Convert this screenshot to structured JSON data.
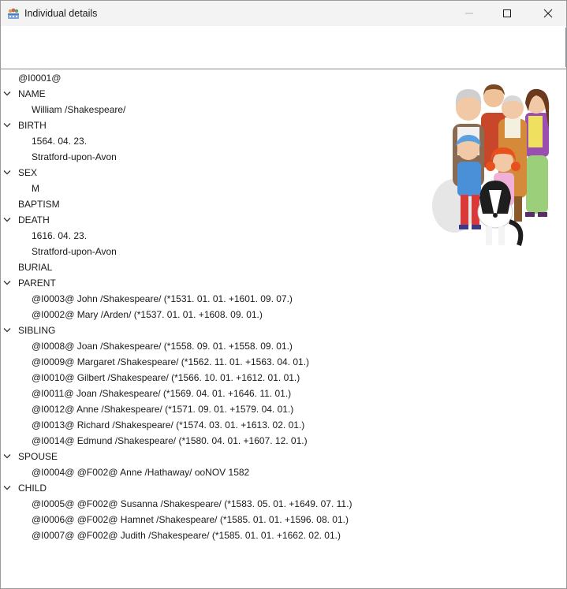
{
  "window": {
    "title": "Individual details",
    "icon": "family-tree-app-icon",
    "controls": [
      "minimize-icon",
      "maximize-icon",
      "close-icon"
    ]
  },
  "tree": {
    "root": "@I0001@",
    "name_label": "NAME",
    "name_value": "William /Shakespeare/",
    "birth_label": "BIRTH",
    "birth_date": "1564. 04. 23.",
    "birth_place": "Stratford-upon-Avon",
    "sex_label": "SEX",
    "sex_value": "M",
    "baptism_label": "BAPTISM",
    "death_label": "DEATH",
    "death_date": "1616. 04. 23.",
    "death_place": "Stratford-upon-Avon",
    "burial_label": "BURIAL",
    "parent_label": "PARENT",
    "parents": [
      "@I0003@ John /Shakespeare/ (*1531. 01. 01. +1601. 09. 07.)",
      "@I0002@ Mary /Arden/ (*1537. 01. 01. +1608. 09. 01.)"
    ],
    "sibling_label": "SIBLING",
    "siblings": [
      "@I0008@ Joan /Shakespeare/ (*1558. 09. 01. +1558. 09. 01.)",
      "@I0009@ Margaret /Shakespeare/ (*1562. 11. 01. +1563. 04. 01.)",
      "@I0010@ Gilbert /Shakespeare/ (*1566. 10. 01. +1612. 01. 01.)",
      "@I0011@ Joan /Shakespeare/ (*1569. 04. 01. +1646. 11. 01.)",
      "@I0012@ Anne /Shakespeare/ (*1571. 09. 01. +1579. 04. 01.)",
      "@I0013@ Richard /Shakespeare/ (*1574. 03. 01. +1613. 02. 01.)",
      "@I0014@ Edmund /Shakespeare/ (*1580. 04. 01. +1607. 12. 01.)"
    ],
    "spouse_label": "SPOUSE",
    "spouses": [
      "@I0004@ @F002@ Anne /Hathaway/ ooNOV 1582"
    ],
    "child_label": "CHILD",
    "children": [
      "@I0005@ @F002@ Susanna /Shakespeare/ (*1583. 05. 01. +1649. 07. 11.)",
      "@I0006@ @F002@ Hamnet /Shakespeare/ (*1585. 01. 01. +1596. 08. 01.)",
      "@I0007@ @F002@ Judith /Shakespeare/ (*1585. 01. 01. +1662. 02. 01.)"
    ]
  },
  "illustration": {
    "icon": "family-illustration"
  },
  "colors": {
    "titlebar": "#f3f3f3",
    "text": "#1a1a1a",
    "chevron": "#333333"
  }
}
